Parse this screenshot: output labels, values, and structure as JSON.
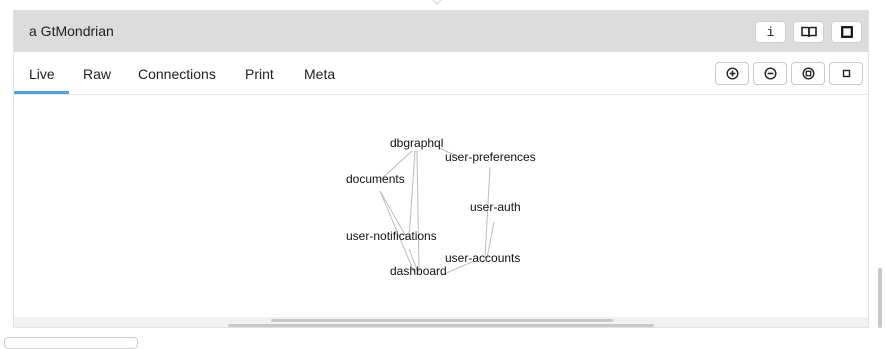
{
  "window": {
    "title": "a GtMondrian",
    "buttons": [
      {
        "name": "info-button",
        "icon": "info-icon",
        "glyph": "i"
      },
      {
        "name": "browse-button",
        "icon": "book-icon"
      },
      {
        "name": "maximize-button",
        "icon": "square-icon"
      }
    ]
  },
  "tabs": [
    {
      "label": "Live",
      "active": true
    },
    {
      "label": "Raw"
    },
    {
      "label": "Connections"
    },
    {
      "label": "Print"
    },
    {
      "label": "Meta"
    }
  ],
  "zoom_buttons": [
    {
      "name": "zoom-in-button",
      "icon": "plus-circle-icon"
    },
    {
      "name": "zoom-out-button",
      "icon": "minus-circle-icon"
    },
    {
      "name": "zoom-fit-button",
      "icon": "fit-icon"
    },
    {
      "name": "zoom-reset-button",
      "icon": "small-square-icon"
    }
  ],
  "graph": {
    "nodes": [
      {
        "id": "dbgraphql",
        "label": "dbgraphql"
      },
      {
        "id": "user-preferences",
        "label": "user-preferences"
      },
      {
        "id": "documents",
        "label": "documents"
      },
      {
        "id": "user-auth",
        "label": "user-auth"
      },
      {
        "id": "user-notifications",
        "label": "user-notifications"
      },
      {
        "id": "user-accounts",
        "label": "user-accounts"
      },
      {
        "id": "dashboard",
        "label": "dashboard"
      }
    ],
    "edge_color": "#bdbdbd"
  },
  "colors": {
    "accent": "#4aa6d8",
    "titlebar": "#dcdcdc"
  }
}
